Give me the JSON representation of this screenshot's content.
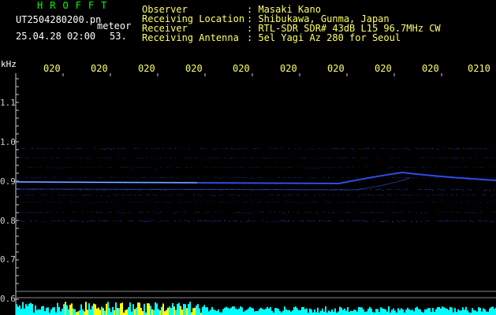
{
  "header": {
    "title": "HROFFT",
    "filename": "UT2504280200.pn",
    "mode": "meteor",
    "datetime": "25.04.28 02:00",
    "count": "53.",
    "fields": [
      {
        "label": "Observer",
        "value": ": Masaki Kano"
      },
      {
        "label": "Receiving Location",
        "value": ": Shibukawa, Gunma, Japan"
      },
      {
        "label": "Receiver",
        "value": ": RTL-SDR SDR# 43dB L15 96.7MHz CW"
      },
      {
        "label": "Receiving Antenna",
        "value": ": 5el Yagi Az 280 for Seoul"
      }
    ]
  },
  "axis": {
    "y_unit": "kHz",
    "x_ticks": [
      "020",
      "020",
      "020",
      "020",
      "020",
      "020",
      "020",
      "020",
      "020",
      "0210"
    ],
    "y_ticks": [
      "1.1",
      "1.0",
      "0.9",
      "0.8",
      "0.7",
      "0.6"
    ]
  },
  "colors": {
    "background": "#000000",
    "grid": "#cccccc",
    "signal": "#3355ff",
    "bright_signal": "#aaddff",
    "bottom_bar": "#00ffff",
    "bottom_peak": "#ffff00"
  }
}
